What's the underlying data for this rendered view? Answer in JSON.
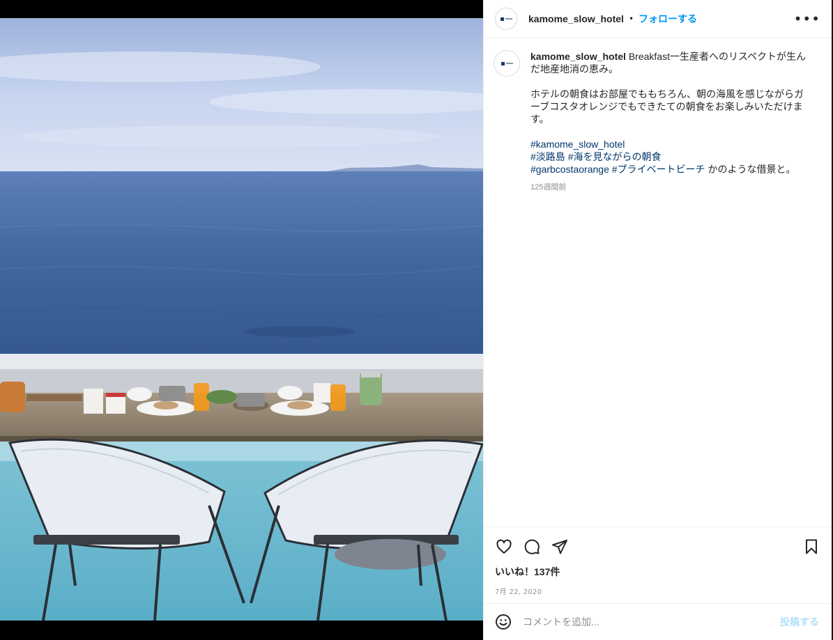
{
  "post": {
    "username": "kamome_slow_hotel",
    "separator": "•",
    "follow_label": "フォローする",
    "more_label": "•••",
    "avatar_icon": "hotel-logo-icon",
    "caption": {
      "username": "kamome_slow_hotel",
      "line1": "Breakfast一生産者へのリスペクトが生んだ地産地消の恵み。",
      "para2": "ホテルの朝食はお部屋でももちろん、朝の海風を感じながらガーブコスタオレンジでもできたての朝食をお楽しみいただけます。",
      "tag1": "#kamome_slow_hotel",
      "tag2": "#淡路島",
      "tag3": "#海を見ながらの朝食",
      "tag4": "#garbcostaorange",
      "tag5": "#プライベートビーチ",
      "trailing": "かのような借景と。",
      "time": "125週間前"
    },
    "actions": {
      "like_icon": "heart-icon",
      "comment_icon": "comment-icon",
      "share_icon": "paper-plane-icon",
      "save_icon": "bookmark-icon"
    },
    "likes": "いいね！137件",
    "date": "7月 22, 2020",
    "comment": {
      "emoji_icon": "smiley-icon",
      "placeholder": "コメントを追加...",
      "post_label": "投稿する"
    }
  },
  "colors": {
    "accent": "#0095f6",
    "hashtag": "#00376b",
    "post_disabled": "#b2dffc",
    "muted": "#8e8e8e"
  }
}
